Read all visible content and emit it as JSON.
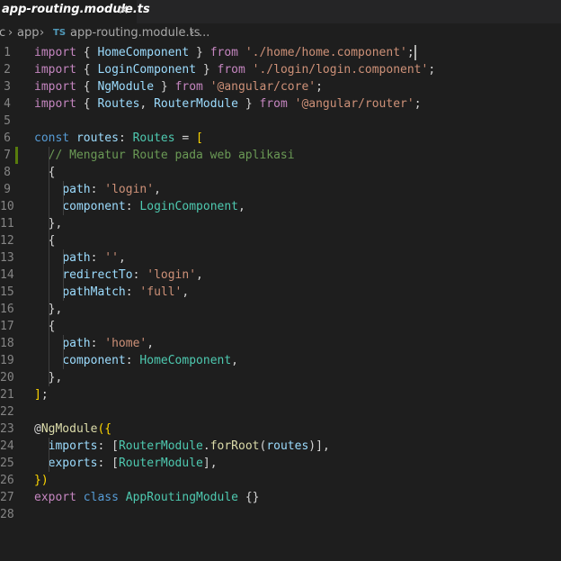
{
  "tab": {
    "title": "app-routing.module.ts",
    "close_glyph": "✕"
  },
  "breadcrumb": {
    "prefix": "c",
    "sep": "›",
    "folder": "app",
    "ts_badge": "TS",
    "file": "app-routing.module.ts",
    "tail": "..."
  },
  "editor": {
    "lines": [
      [
        [
          "import",
          "kw"
        ],
        [
          " { ",
          "punc"
        ],
        [
          "HomeComponent",
          "var"
        ],
        [
          " } ",
          "punc"
        ],
        [
          "from",
          "kw"
        ],
        [
          " ",
          "punc"
        ],
        [
          "'./home/home.component'",
          "str"
        ],
        [
          ";",
          "punc"
        ]
      ],
      [
        [
          "import",
          "kw"
        ],
        [
          " { ",
          "punc"
        ],
        [
          "LoginComponent",
          "var"
        ],
        [
          " } ",
          "punc"
        ],
        [
          "from",
          "kw"
        ],
        [
          " ",
          "punc"
        ],
        [
          "'./login/login.component'",
          "str"
        ],
        [
          ";",
          "punc"
        ]
      ],
      [
        [
          "import",
          "kw"
        ],
        [
          " { ",
          "punc"
        ],
        [
          "NgModule",
          "var"
        ],
        [
          " } ",
          "punc"
        ],
        [
          "from",
          "kw"
        ],
        [
          " ",
          "punc"
        ],
        [
          "'@angular/core'",
          "str"
        ],
        [
          ";",
          "punc"
        ]
      ],
      [
        [
          "import",
          "kw"
        ],
        [
          " { ",
          "punc"
        ],
        [
          "Routes",
          "var"
        ],
        [
          ", ",
          "punc"
        ],
        [
          "RouterModule",
          "var"
        ],
        [
          " } ",
          "punc"
        ],
        [
          "from",
          "kw"
        ],
        [
          " ",
          "punc"
        ],
        [
          "'@angular/router'",
          "str"
        ],
        [
          ";",
          "punc"
        ]
      ],
      [],
      [
        [
          "const",
          "kw2"
        ],
        [
          " ",
          "punc"
        ],
        [
          "routes",
          "var"
        ],
        [
          ": ",
          "punc"
        ],
        [
          "Routes",
          "cls"
        ],
        [
          " = ",
          "punc"
        ],
        [
          "[",
          "brk"
        ]
      ],
      [
        [
          "  ",
          "punc"
        ],
        [
          "// Mengatur Route pada web aplikasi",
          "cmt"
        ]
      ],
      [
        [
          "  ",
          "punc"
        ],
        [
          "{",
          "punc"
        ]
      ],
      [
        [
          "    ",
          "punc"
        ],
        [
          "path",
          "var"
        ],
        [
          ": ",
          "punc"
        ],
        [
          "'login'",
          "str"
        ],
        [
          ",",
          "punc"
        ]
      ],
      [
        [
          "    ",
          "punc"
        ],
        [
          "component",
          "var"
        ],
        [
          ": ",
          "punc"
        ],
        [
          "LoginComponent",
          "cls"
        ],
        [
          ",",
          "punc"
        ]
      ],
      [
        [
          "  ",
          "punc"
        ],
        [
          "},",
          "punc"
        ]
      ],
      [
        [
          "  ",
          "punc"
        ],
        [
          "{",
          "punc"
        ]
      ],
      [
        [
          "    ",
          "punc"
        ],
        [
          "path",
          "var"
        ],
        [
          ": ",
          "punc"
        ],
        [
          "''",
          "str"
        ],
        [
          ",",
          "punc"
        ]
      ],
      [
        [
          "    ",
          "punc"
        ],
        [
          "redirectTo",
          "var"
        ],
        [
          ": ",
          "punc"
        ],
        [
          "'login'",
          "str"
        ],
        [
          ",",
          "punc"
        ]
      ],
      [
        [
          "    ",
          "punc"
        ],
        [
          "pathMatch",
          "var"
        ],
        [
          ": ",
          "punc"
        ],
        [
          "'full'",
          "str"
        ],
        [
          ",",
          "punc"
        ]
      ],
      [
        [
          "  ",
          "punc"
        ],
        [
          "},",
          "punc"
        ]
      ],
      [
        [
          "  ",
          "punc"
        ],
        [
          "{",
          "punc"
        ]
      ],
      [
        [
          "    ",
          "punc"
        ],
        [
          "path",
          "var"
        ],
        [
          ": ",
          "punc"
        ],
        [
          "'home'",
          "str"
        ],
        [
          ",",
          "punc"
        ]
      ],
      [
        [
          "    ",
          "punc"
        ],
        [
          "component",
          "var"
        ],
        [
          ": ",
          "punc"
        ],
        [
          "HomeComponent",
          "cls"
        ],
        [
          ",",
          "punc"
        ]
      ],
      [
        [
          "  ",
          "punc"
        ],
        [
          "},",
          "punc"
        ]
      ],
      [
        [
          "]",
          "brk"
        ],
        [
          ";",
          "punc"
        ]
      ],
      [],
      [
        [
          "@",
          "punc"
        ],
        [
          "NgModule",
          "fn"
        ],
        [
          "({",
          "brk"
        ]
      ],
      [
        [
          "  ",
          "punc"
        ],
        [
          "imports",
          "var"
        ],
        [
          ": ",
          "punc"
        ],
        [
          "[",
          "punc"
        ],
        [
          "RouterModule",
          "cls"
        ],
        [
          ".",
          "punc"
        ],
        [
          "forRoot",
          "fn"
        ],
        [
          "(",
          "punc"
        ],
        [
          "routes",
          "var"
        ],
        [
          ")",
          "punc"
        ],
        [
          "]",
          "punc"
        ],
        [
          ",",
          "punc"
        ]
      ],
      [
        [
          "  ",
          "punc"
        ],
        [
          "exports",
          "var"
        ],
        [
          ": ",
          "punc"
        ],
        [
          "[",
          "punc"
        ],
        [
          "RouterModule",
          "cls"
        ],
        [
          "]",
          "punc"
        ],
        [
          ",",
          "punc"
        ]
      ],
      [
        [
          "})",
          "brk"
        ]
      ],
      [
        [
          "export",
          "kw"
        ],
        [
          " ",
          "punc"
        ],
        [
          "class",
          "kw2"
        ],
        [
          " ",
          "punc"
        ],
        [
          "AppRoutingModule",
          "cls"
        ],
        [
          " ",
          "punc"
        ],
        [
          "{}",
          "punc"
        ]
      ],
      []
    ]
  },
  "colors": {
    "background": "#1e1e1e",
    "tabbar": "#252526",
    "keyword": "#c586c0",
    "storage": "#569cd6",
    "type": "#4ec9b0",
    "variable": "#9cdcfe",
    "string": "#ce9178",
    "comment": "#6a9955",
    "function": "#dcdcaa"
  }
}
